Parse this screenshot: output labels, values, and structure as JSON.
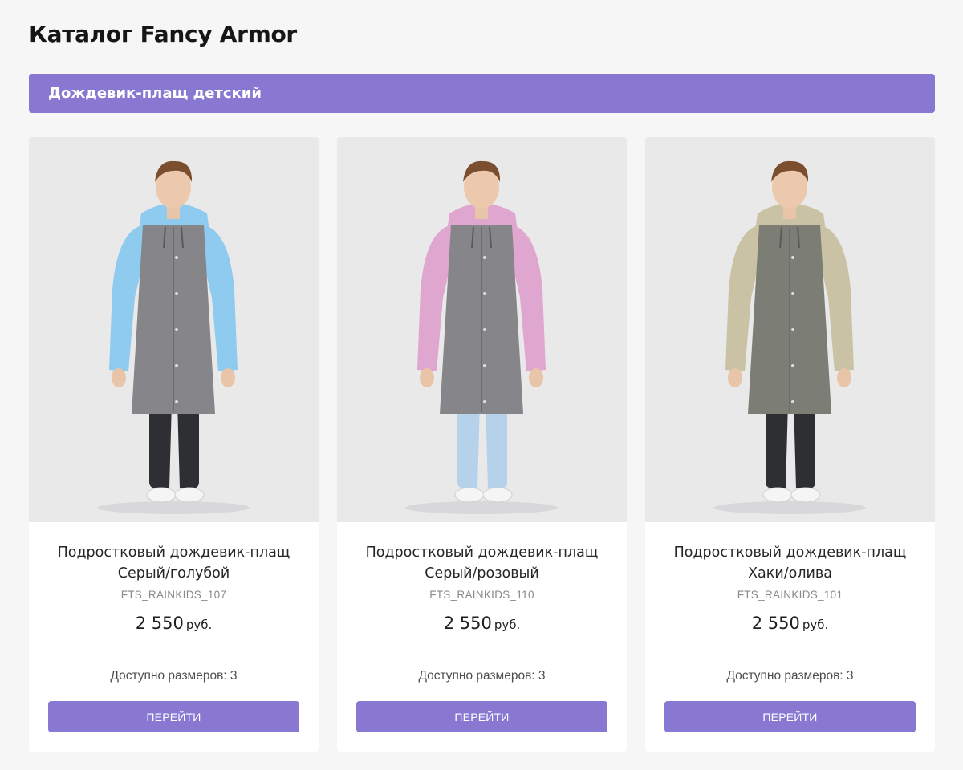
{
  "page": {
    "title": "Каталог Fancy Armor"
  },
  "category": {
    "label": "Дождевик-плащ детский"
  },
  "products": [
    {
      "name_line1": "Подростковый дождевик-плащ",
      "name_line2": "Серый/голубой",
      "sku": "FTS_RAINKIDS_107",
      "price": "2 550",
      "currency": "руб.",
      "sizes_text": "Доступно размеров: 3",
      "button_label": "ПЕРЕЙТИ",
      "sleeve_color": "#8ecbee",
      "body_color": "#86858a",
      "pants_color": "#2e2f33"
    },
    {
      "name_line1": "Подростковый дождевик-плащ",
      "name_line2": "Серый/розовый",
      "sku": "FTS_RAINKIDS_110",
      "price": "2 550",
      "currency": "руб.",
      "sizes_text": "Доступно размеров: 3",
      "button_label": "ПЕРЕЙТИ",
      "sleeve_color": "#dfa6cf",
      "body_color": "#86858a",
      "pants_color": "#b6d1ea"
    },
    {
      "name_line1": "Подростковый дождевик-плащ",
      "name_line2": "Хаки/олива",
      "sku": "FTS_RAINKIDS_101",
      "price": "2 550",
      "currency": "руб.",
      "sizes_text": "Доступно размеров: 3",
      "button_label": "ПЕРЕЙТИ",
      "sleeve_color": "#c9c2a4",
      "body_color": "#7c7d74",
      "pants_color": "#2e2f33"
    }
  ],
  "colors": {
    "accent": "#8878d2",
    "background": "#f6f6f6",
    "card": "#ffffff"
  }
}
